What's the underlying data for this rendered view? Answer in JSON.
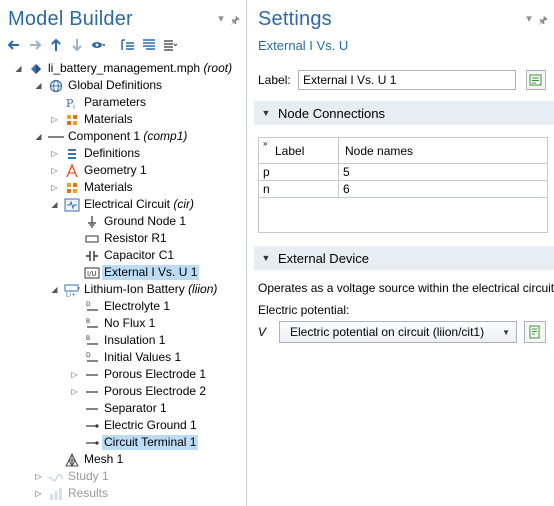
{
  "model_builder": {
    "title": "Model Builder",
    "tree": [
      {
        "label": "li_battery_management.mph",
        "tag": "(root)",
        "icon": "model-root-icon"
      },
      {
        "label": "Global Definitions",
        "tag": "",
        "icon": "globe-icon"
      },
      {
        "label": "Parameters",
        "tag": "",
        "icon": "parameters-icon"
      },
      {
        "label": "Materials",
        "tag": "",
        "icon": "materials-icon"
      },
      {
        "label": "Component 1",
        "tag": "(comp1)",
        "icon": "component-icon"
      },
      {
        "label": "Definitions",
        "tag": "",
        "icon": "definitions-icon"
      },
      {
        "label": "Geometry 1",
        "tag": "",
        "icon": "geometry-icon"
      },
      {
        "label": "Materials",
        "tag": "",
        "icon": "materials-icon"
      },
      {
        "label": "Electrical Circuit",
        "tag": "(cir)",
        "icon": "electrical-circuit-icon"
      },
      {
        "label": "Ground Node 1",
        "tag": "",
        "icon": "ground-node-icon"
      },
      {
        "label": "Resistor R1",
        "tag": "",
        "icon": "resistor-icon"
      },
      {
        "label": "Capacitor C1",
        "tag": "",
        "icon": "capacitor-icon"
      },
      {
        "label": "External I Vs. U 1",
        "tag": "",
        "icon": "external-iv-icon"
      },
      {
        "label": "Lithium-Ion Battery",
        "tag": "(liion)",
        "icon": "battery-icon"
      },
      {
        "label": "Electrolyte 1",
        "tag": "",
        "icon": "domain-node-icon"
      },
      {
        "label": "No Flux 1",
        "tag": "",
        "icon": "boundary-node-icon"
      },
      {
        "label": "Insulation 1",
        "tag": "",
        "icon": "boundary-node-icon"
      },
      {
        "label": "Initial Values 1",
        "tag": "",
        "icon": "domain-node-icon"
      },
      {
        "label": "Porous Electrode 1",
        "tag": "",
        "icon": "line-node-icon"
      },
      {
        "label": "Porous Electrode 2",
        "tag": "",
        "icon": "line-node-icon"
      },
      {
        "label": "Separator 1",
        "tag": "",
        "icon": "line-node-icon"
      },
      {
        "label": "Electric Ground 1",
        "tag": "",
        "icon": "point-node-icon"
      },
      {
        "label": "Circuit Terminal 1",
        "tag": "",
        "icon": "point-node-icon"
      },
      {
        "label": "Mesh 1",
        "tag": "",
        "icon": "mesh-icon"
      },
      {
        "label": "Study 1",
        "tag": "",
        "icon": "study-icon"
      },
      {
        "label": "Results",
        "tag": "",
        "icon": "results-icon"
      }
    ]
  },
  "settings": {
    "title": "Settings",
    "subtitle": "External I Vs. U",
    "label_key": "Label:",
    "label_value": "External I Vs. U 1",
    "node_connections": {
      "header": "Node Connections",
      "columns": [
        "Label",
        "Node names"
      ],
      "rows": [
        {
          "label": "p",
          "node": "5"
        },
        {
          "label": "n",
          "node": "6"
        }
      ]
    },
    "external_device": {
      "header": "External Device",
      "description": "Operates as a voltage source within the electrical circuit",
      "potential_label": "Electric potential:",
      "variable": "V",
      "selected": "Electric potential on circuit (liion/cit1)"
    }
  },
  "colors": {
    "accent": "#2a6aa8",
    "selection": "#bcdcf6",
    "section_bg": "#e8edf2"
  }
}
